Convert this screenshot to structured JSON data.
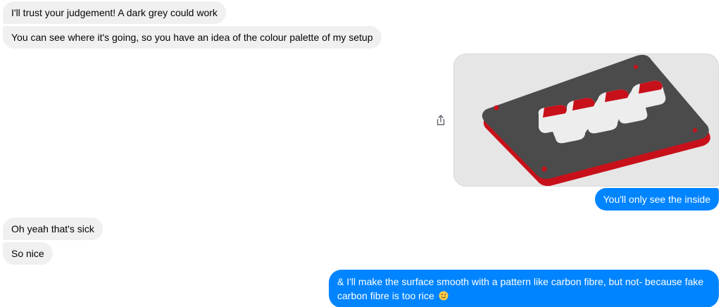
{
  "messages": {
    "in_1": "I'll trust your judgement! A dark grey could work",
    "in_2": "You can see where it's going, so you have an idea of the colour palette of my setup",
    "out_1": "You'll only see the inside",
    "in_3": "Oh yeah that's sick",
    "in_4": "So nice",
    "out_2": "& I'll make the surface smooth with a pattern like carbon fibre, but not- because fake carbon fibre is too rice"
  },
  "icons": {
    "share": "share-icon",
    "emoji": "winking-face-emoji"
  },
  "colors": {
    "outgoing_bubble": "#0084ff",
    "incoming_bubble": "#f0f0f0",
    "plate_top": "#4a4a4a",
    "plate_side": "#c8101a"
  }
}
